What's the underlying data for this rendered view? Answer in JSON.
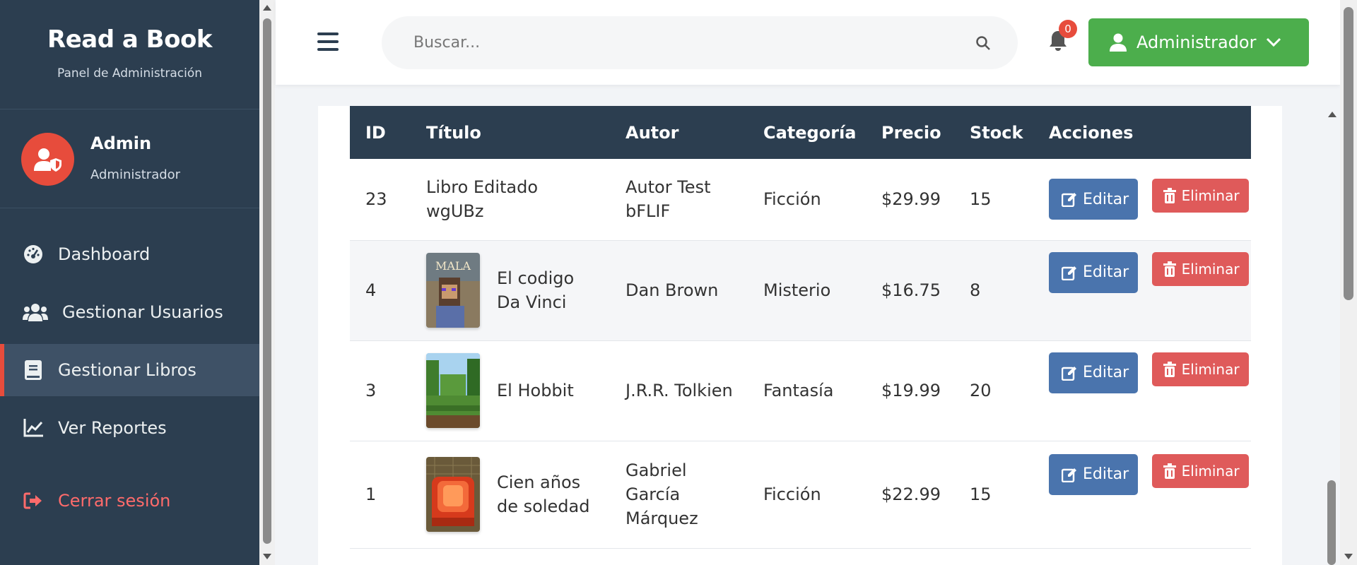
{
  "sidebar": {
    "brand_title": "Read a Book",
    "brand_subtitle": "Panel de Administración",
    "profile": {
      "name": "Admin",
      "role": "Administrador"
    },
    "menu": [
      {
        "label": "Dashboard",
        "icon": "dashboard-icon"
      },
      {
        "label": "Gestionar Usuarios",
        "icon": "users-icon"
      },
      {
        "label": "Gestionar Libros",
        "icon": "book-icon",
        "active": true
      },
      {
        "label": "Ver Reportes",
        "icon": "chart-icon"
      }
    ],
    "logout_label": "Cerrar sesión"
  },
  "header": {
    "search_placeholder": "Buscar...",
    "notification_count": "0",
    "user_button_label": "Administrador"
  },
  "table": {
    "columns": [
      "ID",
      "Título",
      "Autor",
      "Categoría",
      "Precio",
      "Stock",
      "Acciones"
    ],
    "rows": [
      {
        "id": "23",
        "title_line1": "Libro Editado",
        "title_line2": "wgUBz",
        "author_line1": "Autor Test",
        "author_line2": "bFLIF",
        "author_line3": "",
        "category": "Ficción",
        "price": "$29.99",
        "stock": "15"
      },
      {
        "id": "4",
        "title_line1": "El codigo",
        "title_line2": "Da Vinci",
        "author_line1": "Dan Brown",
        "author_line2": "",
        "author_line3": "",
        "category": "Misterio",
        "price": "$16.75",
        "stock": "8",
        "cover_text": "MALA"
      },
      {
        "id": "3",
        "title_line1": "El Hobbit",
        "title_line2": "",
        "author_line1": "J.R.R. Tolkien",
        "author_line2": "",
        "author_line3": "",
        "category": "Fantasía",
        "price": "$19.99",
        "stock": "20"
      },
      {
        "id": "1",
        "title_line1": "Cien años",
        "title_line2": "de soledad",
        "author_line1": "Gabriel",
        "author_line2": "García",
        "author_line3": "Márquez",
        "category": "Ficción",
        "price": "$22.99",
        "stock": "15"
      }
    ],
    "edit_label": "Editar",
    "delete_label": "Eliminar"
  },
  "colors": {
    "sidebar_bg": "#2c3e50",
    "accent_red": "#e74c3c",
    "success_green": "#4cae4c",
    "edit_blue": "#4a74ad",
    "delete_red": "#df5a5a"
  }
}
